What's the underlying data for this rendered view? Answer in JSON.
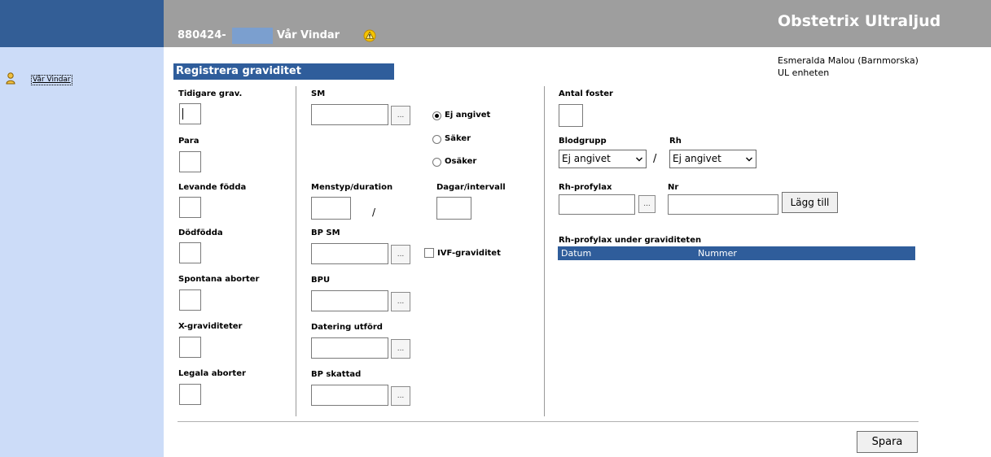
{
  "header": {
    "patient_id": "880424-",
    "patient_name": "Vår Vindar",
    "app_title": "Obstetrix Ultraljud"
  },
  "sidebar": {
    "patient_link": "Vår Vindar"
  },
  "user": {
    "role": "Esmeralda Malou (Barnmorska)",
    "unit": "UL enheten"
  },
  "form": {
    "title": "Registrera graviditet",
    "col1": {
      "tidigare_grav": "Tidigare grav.",
      "para": "Para",
      "levande_fodda": "Levande födda",
      "dodfodda": "Dödfödda",
      "spontana_aborter": "Spontana aborter",
      "x_graviditeter": "X-graviditeter",
      "legala_aborter": "Legala aborter"
    },
    "col2": {
      "sm": "SM",
      "menstyp": "Menstyp/duration",
      "slash": "/",
      "dagar_intervall": "Dagar/intervall",
      "bp_sm": "BP SM",
      "bpu": "BPU",
      "datering_utford": "Datering utförd",
      "bp_skattad": "BP skattad",
      "ellipsis": "..."
    },
    "sm_status": {
      "options": [
        "Ej angivet",
        "Säker",
        "Osäker"
      ],
      "selected": "Ej angivet"
    },
    "ivf_label": "IVF-graviditet",
    "col3": {
      "antal_foster": "Antal foster",
      "blodgrupp": "Blodgrupp",
      "blodgrupp_value": "Ej angivet",
      "rh": "Rh",
      "rh_value": "Ej angivet",
      "rh_profylax": "Rh-profylax",
      "nr": "Nr",
      "lagg_till": "Lägg till",
      "rh_table_title": "Rh-profylax under graviditeten",
      "rh_table_columns": [
        "Datum",
        "Nummer"
      ]
    },
    "save_label": "Spara"
  },
  "colors": {
    "header_blue": "#335e96",
    "header_gray": "#9e9e9e",
    "sidebar_bg": "#ccdcf8",
    "section_blue": "#2f5d9b"
  }
}
